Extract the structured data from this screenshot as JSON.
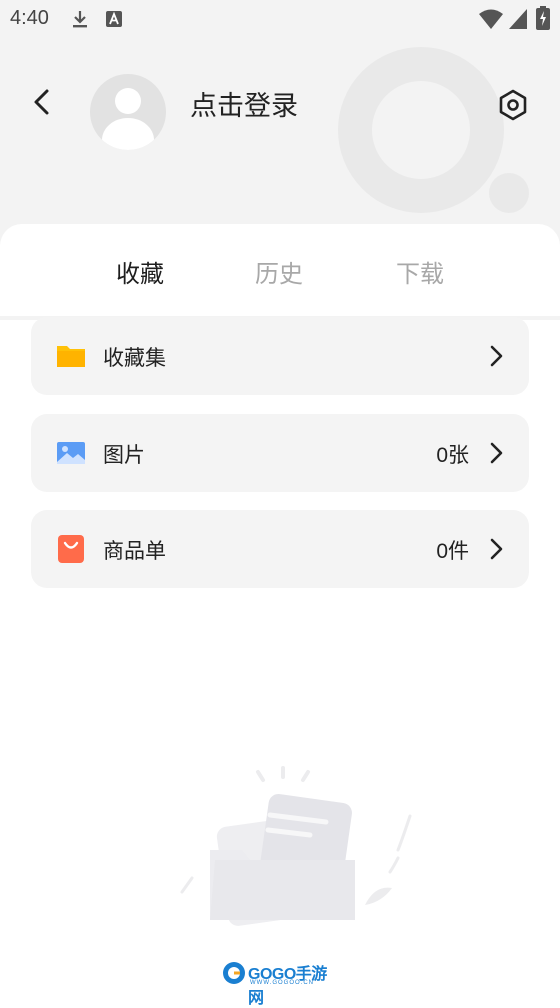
{
  "status_bar": {
    "time": "4:40",
    "icons": [
      "download-icon",
      "font-a-icon",
      "wifi-icon",
      "signal-icon",
      "battery-charging-icon"
    ]
  },
  "header": {
    "login_label": "点击登录",
    "back_icon": "chevron-left-icon",
    "settings_icon": "hexagon-settings-icon"
  },
  "tabs": [
    {
      "label": "收藏",
      "active": true
    },
    {
      "label": "历史",
      "active": false
    },
    {
      "label": "下载",
      "active": false
    }
  ],
  "list": [
    {
      "label": "收藏集",
      "count": "",
      "icon": "folder-icon",
      "color": "#ffb300"
    },
    {
      "label": "图片",
      "count": "0张",
      "icon": "image-icon",
      "color": "#5b9cf5"
    },
    {
      "label": "商品单",
      "count": "0件",
      "icon": "shopping-bag-icon",
      "color": "#ff6b4a"
    }
  ],
  "watermark": {
    "brand": "GOGO手游网",
    "url": "WWW.GOGOO.CN"
  }
}
